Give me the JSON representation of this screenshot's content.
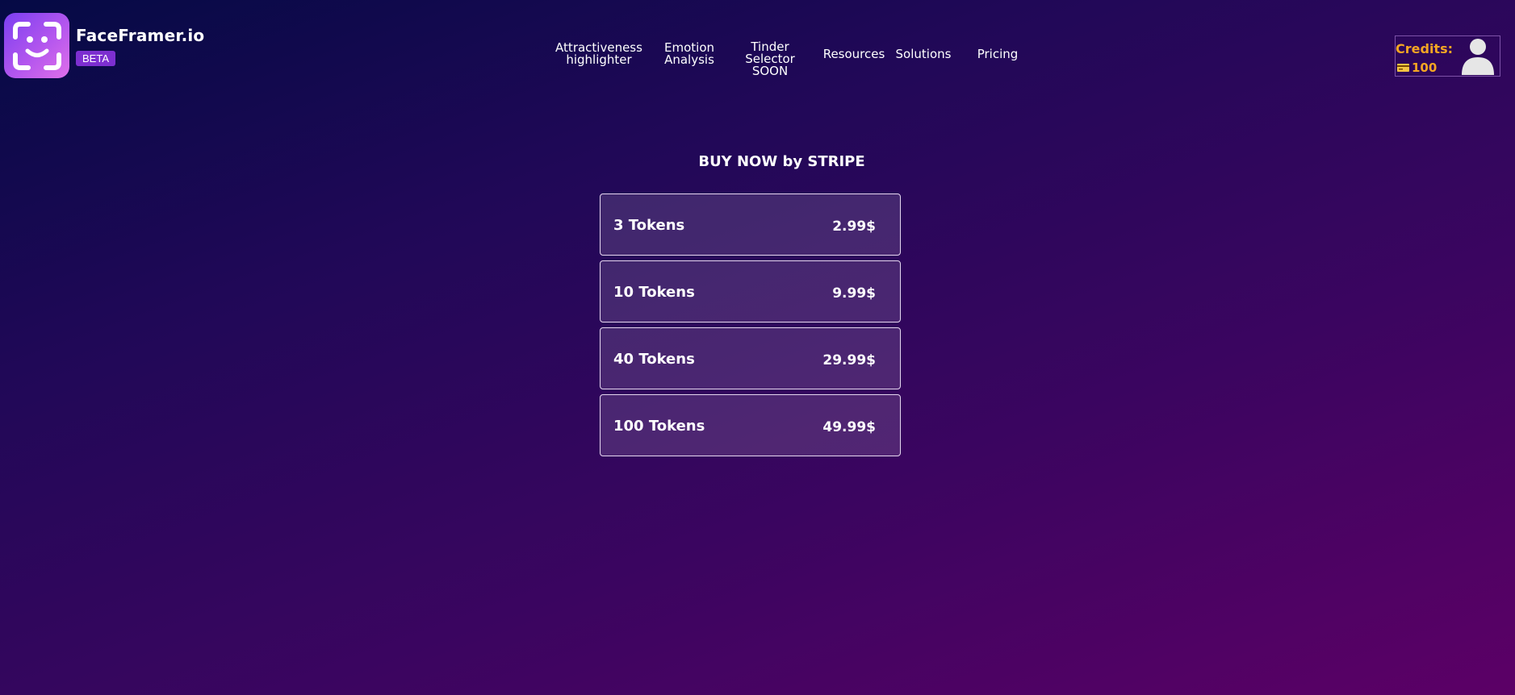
{
  "brand": {
    "name": "FaceFramer.io",
    "badge": "BETA"
  },
  "nav": [
    {
      "line1": "Attractiveness",
      "line2": "highlighter",
      "line3": ""
    },
    {
      "line1": "Emotion",
      "line2": "Analysis",
      "line3": ""
    },
    {
      "line1": "Tinder",
      "line2": "Selector",
      "line3": "SOON"
    },
    {
      "line1": "Resources",
      "line2": "",
      "line3": ""
    },
    {
      "line1": "Solutions",
      "line2": "",
      "line3": ""
    },
    {
      "line1": "Pricing",
      "line2": "",
      "line3": ""
    }
  ],
  "account": {
    "credits_label": "Credits:",
    "credits_value": "100",
    "credits_icon": "credit-card-icon",
    "avatar_icon": "user-icon"
  },
  "main": {
    "title": "BUY NOW by STRIPE",
    "plans": [
      {
        "name": "3 Tokens",
        "price": "2.99$"
      },
      {
        "name": "10 Tokens",
        "price": "9.99$"
      },
      {
        "name": "40 Tokens",
        "price": "29.99$"
      },
      {
        "name": "100 Tokens",
        "price": "49.99$"
      }
    ]
  },
  "colors": {
    "accent": "#f5a623",
    "beta_badge": "#7d2fd0",
    "logo_gradient_start": "#7b3ff0",
    "logo_gradient_end": "#e070ea"
  }
}
